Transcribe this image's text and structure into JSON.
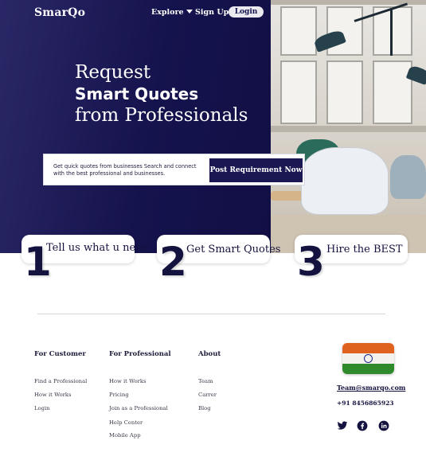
{
  "brand": {
    "logo": "SmarQo"
  },
  "nav": {
    "explore": "Explore",
    "signup": "Sign Up",
    "login": "Login"
  },
  "hero": {
    "line1": "Request",
    "line2": "Smart Quotes",
    "line3": "from Professionals",
    "quote_text": "Get quick quotes from businesses Search and connect with the best professional and businesses.",
    "post_button": "Post Requirement Now"
  },
  "steps": [
    {
      "number": "1",
      "label": "Tell us what u need"
    },
    {
      "number": "2",
      "label": "Get Smart Quotes"
    },
    {
      "number": "3",
      "label": "Hire the BEST"
    }
  ],
  "footer": {
    "customer": {
      "heading": "For Customer",
      "links": [
        "Find a Professional",
        "How it Works",
        "Login"
      ]
    },
    "professional": {
      "heading": "For Professional",
      "links": [
        "How it Works",
        "Pricing",
        "Join as a Professional",
        "Help Center",
        "Mobile App"
      ]
    },
    "about": {
      "heading": "About",
      "links": [
        "Team",
        "Carrer",
        "Blog"
      ]
    },
    "email": "Team@smarqo.com",
    "phone": "+91 8456865923",
    "social_icons": [
      "twitter-icon",
      "facebook-icon",
      "linkedin-icon"
    ]
  },
  "colors": {
    "navy": "#15134d",
    "accent_button": "#1a1752"
  }
}
